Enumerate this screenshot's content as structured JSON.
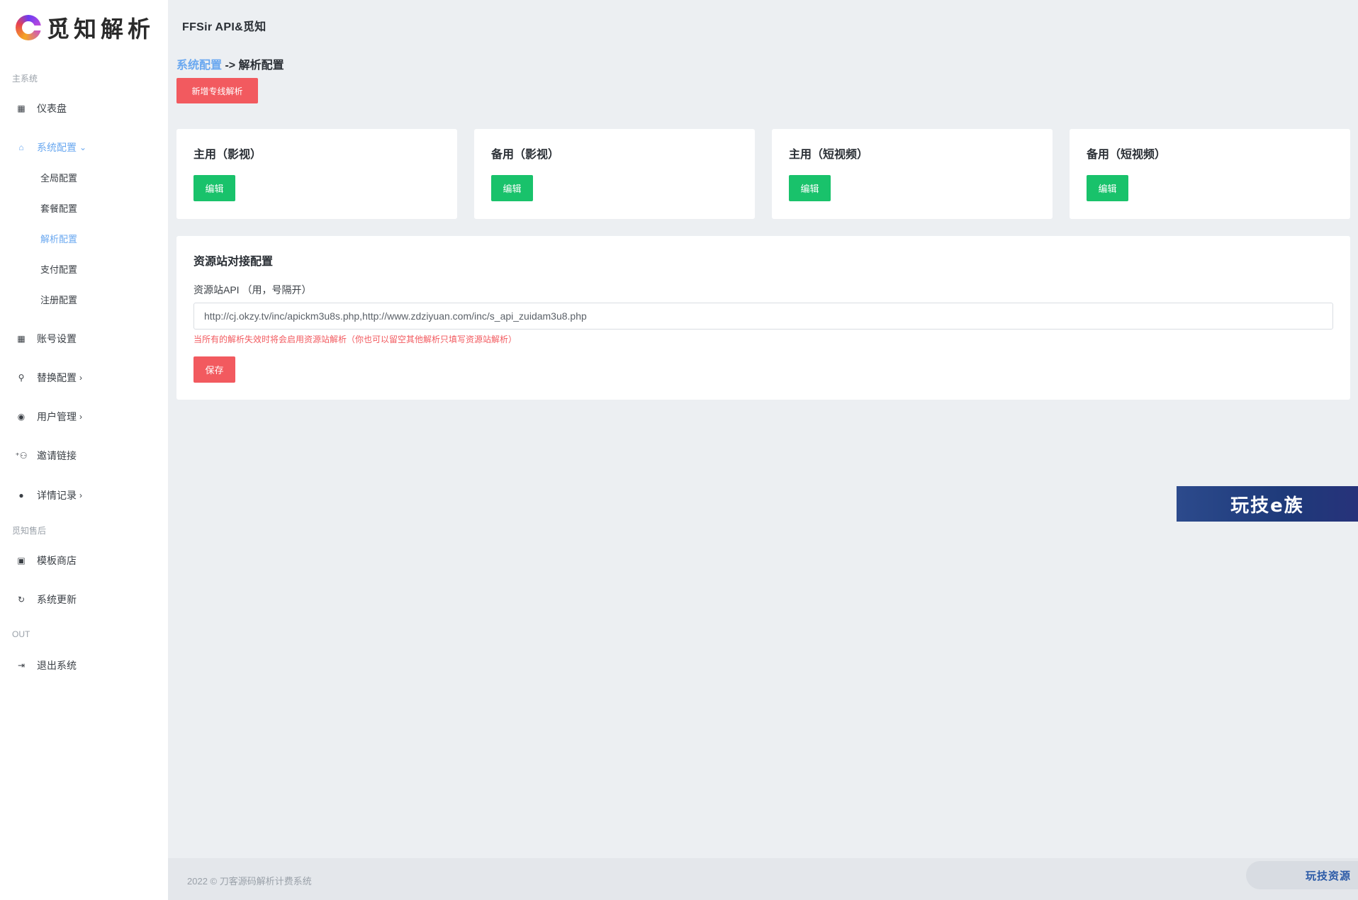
{
  "brand": {
    "logo_text": "觅知解析"
  },
  "header": {
    "title": "FFSir API&觅知"
  },
  "sidebar": {
    "section_main": "主系统",
    "dashboard": "仪表盘",
    "system_config": "系统配置",
    "sub": [
      "全局配置",
      "套餐配置",
      "解析配置",
      "支付配置",
      "注册配置"
    ],
    "account_settings": "账号设置",
    "replace_config": "替换配置",
    "user_management": "用户管理",
    "invite_link": "邀请链接",
    "detail_records": "详情记录",
    "section_after": "觅知售后",
    "template_store": "模板商店",
    "system_update": "系统更新",
    "section_out": "OUT",
    "logout": "退出系统"
  },
  "breadcrumb": {
    "parent": "系统配置",
    "arrow": "->",
    "current": "解析配置"
  },
  "actions": {
    "new_line": "新增专线解析"
  },
  "cards": [
    {
      "title": "主用（影视）",
      "button": "编辑"
    },
    {
      "title": "备用（影视）",
      "button": "编辑"
    },
    {
      "title": "主用（短视频）",
      "button": "编辑"
    },
    {
      "title": "备用（短视频）",
      "button": "编辑"
    }
  ],
  "resource": {
    "title": "资源站对接配置",
    "label": "资源站API （用，号隔开）",
    "value": "http://cj.okzy.tv/inc/apickm3u8s.php,http://www.zdziyuan.com/inc/s_api_zuidam3u8.php",
    "hint": "当所有的解析失效时将会启用资源站解析（你也可以留空其他解析只填写资源站解析）",
    "save": "保存"
  },
  "watermark": {
    "banner": "玩技e族",
    "footer_mark": "玩技资源"
  },
  "footer": {
    "copyright": "2022 © 刀客源码解析计费系统"
  },
  "colors": {
    "accent": "#6aa8f0",
    "danger": "#f25a5f",
    "success": "#19c26b"
  }
}
